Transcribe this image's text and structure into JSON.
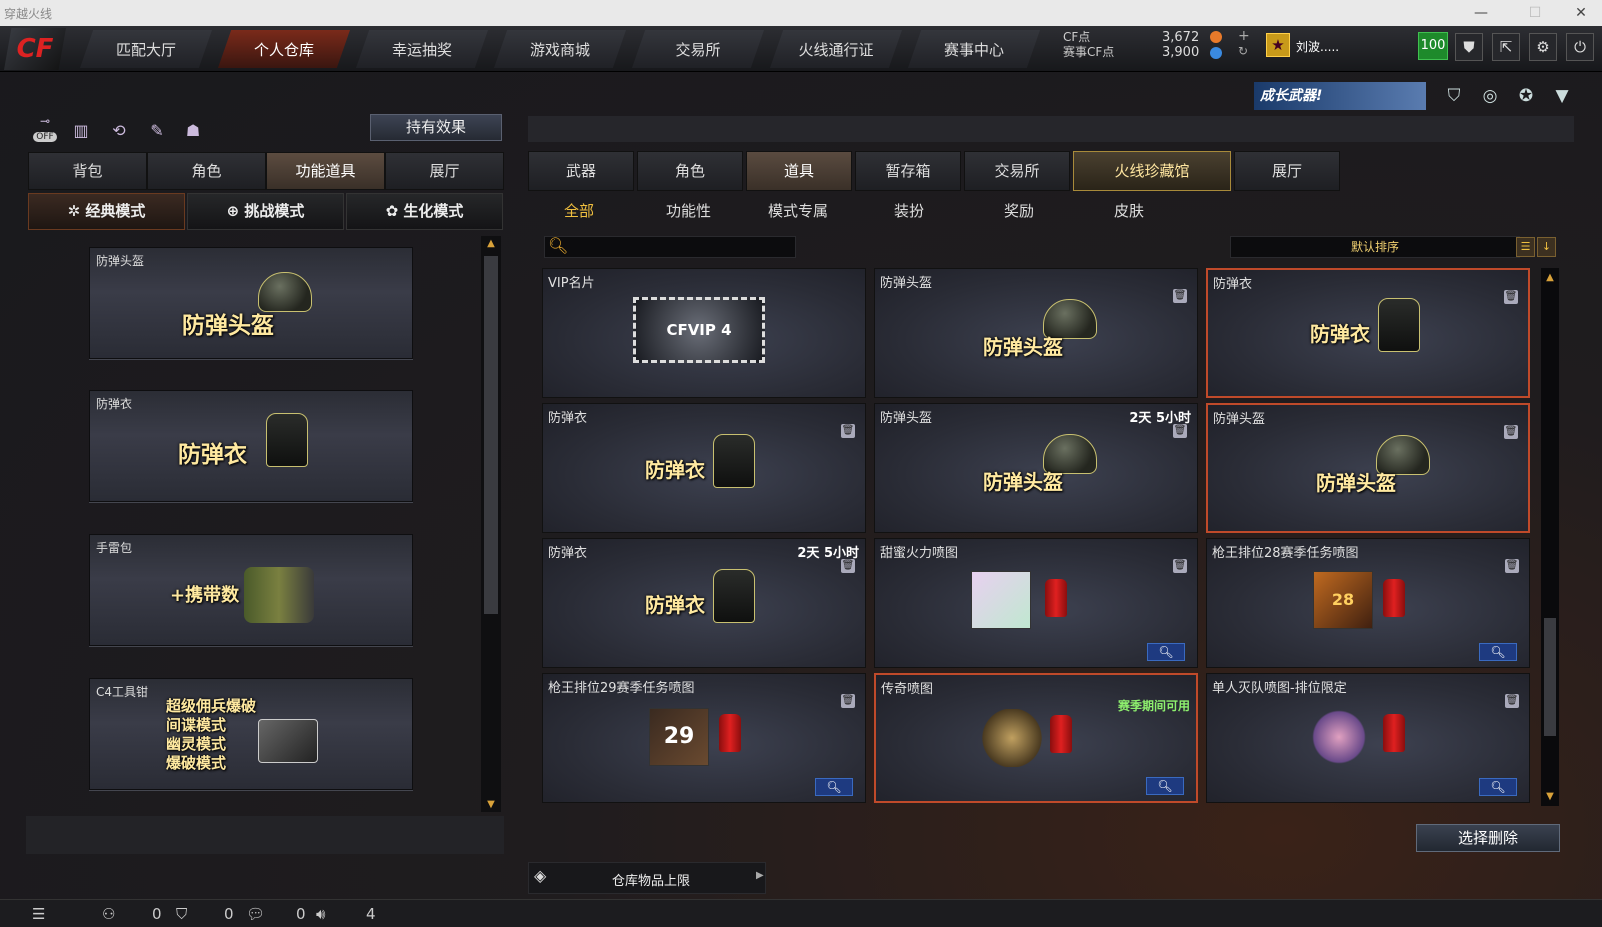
{
  "window": {
    "title": "穿越火线",
    "min": "—",
    "max": "☐",
    "close": "✕"
  },
  "nav": {
    "logo": "CF",
    "tabs": [
      {
        "label": "匹配大厅"
      },
      {
        "label": "个人仓库"
      },
      {
        "label": "幸运抽奖"
      },
      {
        "label": "游戏商城"
      },
      {
        "label": "交易所"
      },
      {
        "label": "火线通行证"
      },
      {
        "label": "赛事中心"
      }
    ],
    "active_tab": "个人仓库",
    "cf_label": "CF点",
    "cf_value": "3,672",
    "match_label": "赛事CF点",
    "match_value": "3,900",
    "username": "刘波.....",
    "level": "100",
    "icons": [
      "shield-icon",
      "exit-icon",
      "gear-icon",
      "power-icon"
    ]
  },
  "banner": {
    "text": "成长武器!"
  },
  "left": {
    "hold_effect": "持有效果",
    "off_label": "OFF",
    "tabs": [
      {
        "label": "背包"
      },
      {
        "label": "角色"
      },
      {
        "label": "功能道具"
      },
      {
        "label": "展厅"
      }
    ],
    "active_tab": "功能道具",
    "modes": [
      {
        "label": "经典模式"
      },
      {
        "label": "挑战模式"
      },
      {
        "label": "生化模式"
      }
    ],
    "active_mode": "经典模式",
    "items": [
      {
        "name": "防弹头盔",
        "big": "防弹头盔"
      },
      {
        "name": "防弹衣",
        "big": "防弹衣"
      },
      {
        "name": "手雷包",
        "big": "+携带数"
      },
      {
        "name": "C4工具钳",
        "modes": [
          "超级佣兵爆破",
          "间谍模式",
          "幽灵模式",
          "爆破模式"
        ]
      }
    ]
  },
  "right": {
    "tabs": [
      {
        "label": "武器"
      },
      {
        "label": "角色"
      },
      {
        "label": "道具"
      },
      {
        "label": "暂存箱"
      },
      {
        "label": "交易所"
      },
      {
        "label": "火线珍藏馆"
      },
      {
        "label": "展厅"
      }
    ],
    "active_tab": "道具",
    "subtabs": [
      {
        "label": "全部"
      },
      {
        "label": "功能性"
      },
      {
        "label": "模式专属"
      },
      {
        "label": "装扮"
      },
      {
        "label": "奖励"
      },
      {
        "label": "皮肤"
      }
    ],
    "active_subtab": "全部",
    "search_placeholder": "",
    "sort_label": "默认排序",
    "grid": [
      {
        "name": "VIP名片",
        "vip": "CFVIP 4"
      },
      {
        "name": "防弹头盔",
        "big": "防弹头盔"
      },
      {
        "name": "防弹衣",
        "big": "防弹衣"
      },
      {
        "name": "防弹衣",
        "big": "防弹衣"
      },
      {
        "name": "防弹头盔",
        "big": "防弹头盔",
        "time": "2天 5小时"
      },
      {
        "name": "防弹头盔",
        "big": "防弹头盔"
      },
      {
        "name": "防弹衣",
        "big": "防弹衣",
        "time": "2天 5小时"
      },
      {
        "name": "甜蜜火力喷图"
      },
      {
        "name": "枪王排位28赛季任务喷图",
        "badge": "28"
      },
      {
        "name": "枪王排位29赛季任务喷图",
        "badge": "29"
      },
      {
        "name": "传奇喷图",
        "avail": "赛季期间可用"
      },
      {
        "name": "单人灭队喷图-排位限定"
      }
    ],
    "delete_select": "选择删除",
    "capacity": "仓库物品上限"
  },
  "status": {
    "v1": "0",
    "v2": "0",
    "v3": "0",
    "v4": "4"
  }
}
